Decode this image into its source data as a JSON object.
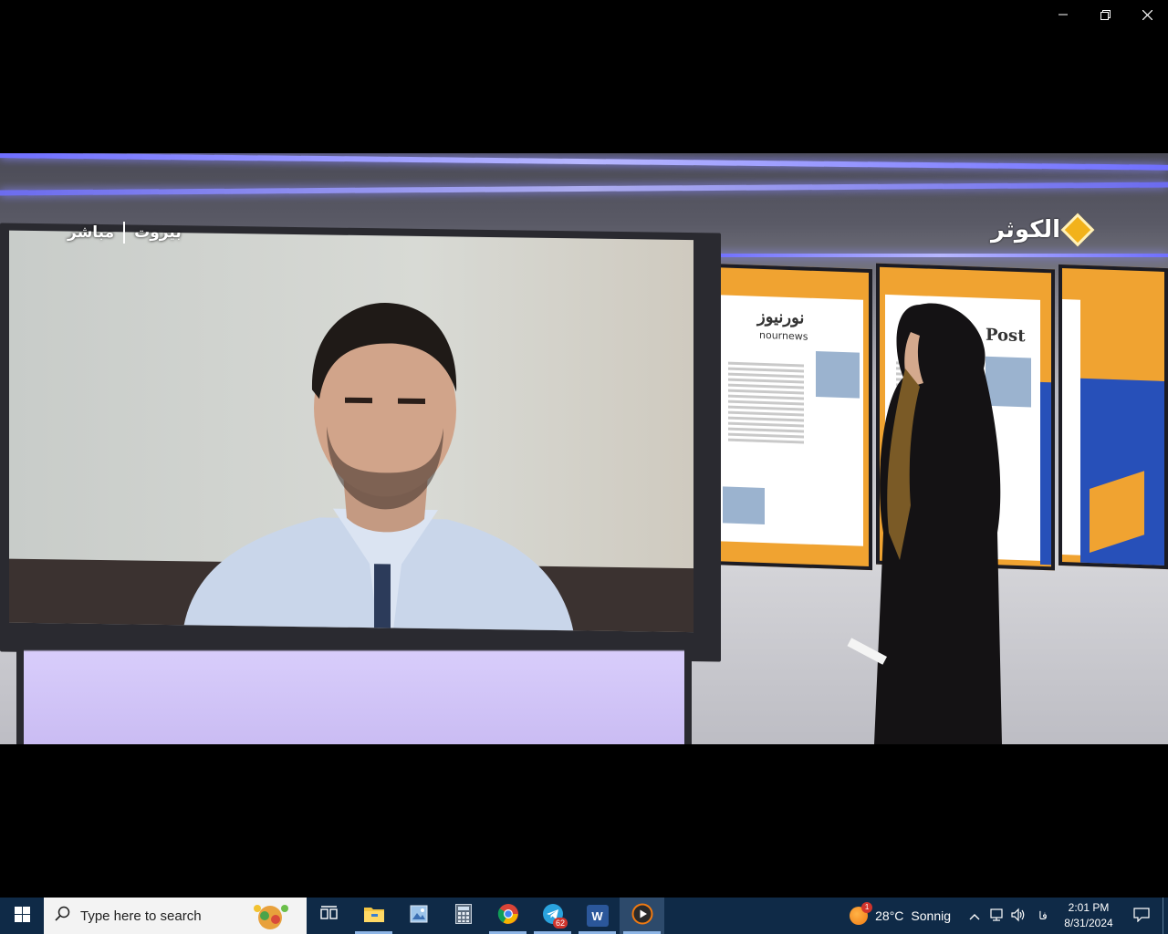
{
  "window": {
    "controls": {
      "minimize_icon": "minimize-icon",
      "restore_icon": "restore-icon",
      "close_icon": "close-icon"
    }
  },
  "video": {
    "channel_logo_text": "الكوثر",
    "location_city": "بيروت",
    "location_live": "مباشر",
    "wall_paper_1_title": "نورنيوز",
    "wall_paper_1_subtitle": "nournews",
    "wall_paper_2_title": "Post",
    "colors": {
      "accent_orange": "#f0a331",
      "accent_blue": "#2750b9",
      "neon": "#8a8aff"
    }
  },
  "taskbar": {
    "start_icon": "windows-logo-icon",
    "search_placeholder": "Type here to search",
    "apps": [
      {
        "name": "task-view",
        "icon": "task-view-icon"
      },
      {
        "name": "file-explorer",
        "icon": "folder-icon"
      },
      {
        "name": "photos",
        "icon": "photos-icon"
      },
      {
        "name": "calculator",
        "icon": "calculator-icon"
      },
      {
        "name": "chrome",
        "icon": "chrome-icon"
      },
      {
        "name": "telegram",
        "icon": "telegram-icon",
        "badge": "62"
      },
      {
        "name": "word",
        "icon": "word-icon",
        "label": "W"
      },
      {
        "name": "media-player",
        "icon": "media-player-icon"
      }
    ],
    "weather": {
      "temperature": "28°C",
      "condition": "Sonnig",
      "alert_count": "1"
    },
    "tray": {
      "lang": "فا"
    },
    "clock": {
      "time": "2:01 PM",
      "date": "8/31/2024"
    },
    "colors": {
      "taskbar_bg": "#0f2a47",
      "search_bg": "#f3f3f3"
    }
  }
}
